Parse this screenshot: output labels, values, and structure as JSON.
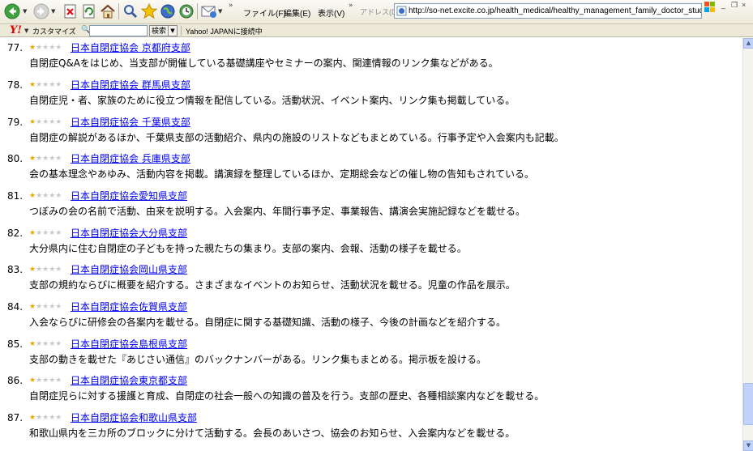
{
  "toolbar": {
    "menu": [
      "ファイル(F)",
      "編集(E)",
      "表示(V)"
    ],
    "address_label": "アドレス(D)",
    "url": "http://so-net.excite.co.jp/health_medical/healthy_management_family_doctor_study/chil"
  },
  "yahoo_bar": {
    "customize": "カスタマイズ",
    "search_button": "検索",
    "connect": "Yahoo! JAPANに接続中"
  },
  "entries": [
    {
      "num": "77.",
      "rating": 1,
      "title": "日本自閉症協会 京都府支部",
      "desc": "自閉症Q&Aをはじめ、当支部が開催している基礎講座やセミナーの案内、関連情報のリンク集などがある。"
    },
    {
      "num": "78.",
      "rating": 1,
      "title": "日本自閉症協会 群馬県支部",
      "desc": "自閉症児・者、家族のために役立つ情報を配信している。活動状況、イベント案内、リンク集も掲載している。"
    },
    {
      "num": "79.",
      "rating": 1,
      "title": "日本自閉症協会 千葉県支部",
      "desc": "自閉症の解説があるほか、千葉県支部の活動紹介、県内の施設のリストなどもまとめている。行事予定や入会案内も記載。"
    },
    {
      "num": "80.",
      "rating": 1,
      "title": "日本自閉症協会 兵庫県支部",
      "desc": "会の基本理念やあゆみ、活動内容を掲載。講演録を整理しているほか、定期総会などの催し物の告知もされている。"
    },
    {
      "num": "81.",
      "rating": 1,
      "title": "日本自閉症協会愛知県支部",
      "desc": "つぼみの会の名前で活動、由来を説明する。入会案内、年間行事予定、事業報告、講演会実施記録などを載せる。"
    },
    {
      "num": "82.",
      "rating": 1,
      "title": "日本自閉症協会大分県支部",
      "desc": "大分県内に住む自閉症の子どもを持った親たちの集まり。支部の案内、会報、活動の様子を載せる。"
    },
    {
      "num": "83.",
      "rating": 1,
      "title": "日本自閉症協会岡山県支部",
      "desc": "支部の規約ならびに概要を紹介する。さまざまなイベントのお知らせ、活動状況を載せる。児童の作品を展示。"
    },
    {
      "num": "84.",
      "rating": 1,
      "title": "日本自閉症協会佐賀県支部",
      "desc": "入会ならびに研修会の各案内を載せる。自閉症に関する基礎知識、活動の様子、今後の計画などを紹介する。"
    },
    {
      "num": "85.",
      "rating": 1,
      "title": "日本自閉症協会島根県支部",
      "desc": "支部の動きを載せた『あじさい通信』のバックナンバーがある。リンク集もまとめる。掲示板を設ける。"
    },
    {
      "num": "86.",
      "rating": 1,
      "title": "日本自閉症協会東京都支部",
      "desc": "自閉症児らに対する援護と育成、自閉症の社会一般への知識の普及を行う。支部の歴史、各種相談案内などを載せる。"
    },
    {
      "num": "87.",
      "rating": 1,
      "title": "日本自閉症協会和歌山県支部",
      "desc": "和歌山県内を三カ所のブロックに分けて活動する。会長のあいさつ、協会のお知らせ、入会案内などを載せる。"
    }
  ],
  "colors": {
    "link": "#0000ee",
    "star_on": "#e7a900",
    "star_off": "#c9c9c9",
    "chrome": "#ece9d8"
  }
}
